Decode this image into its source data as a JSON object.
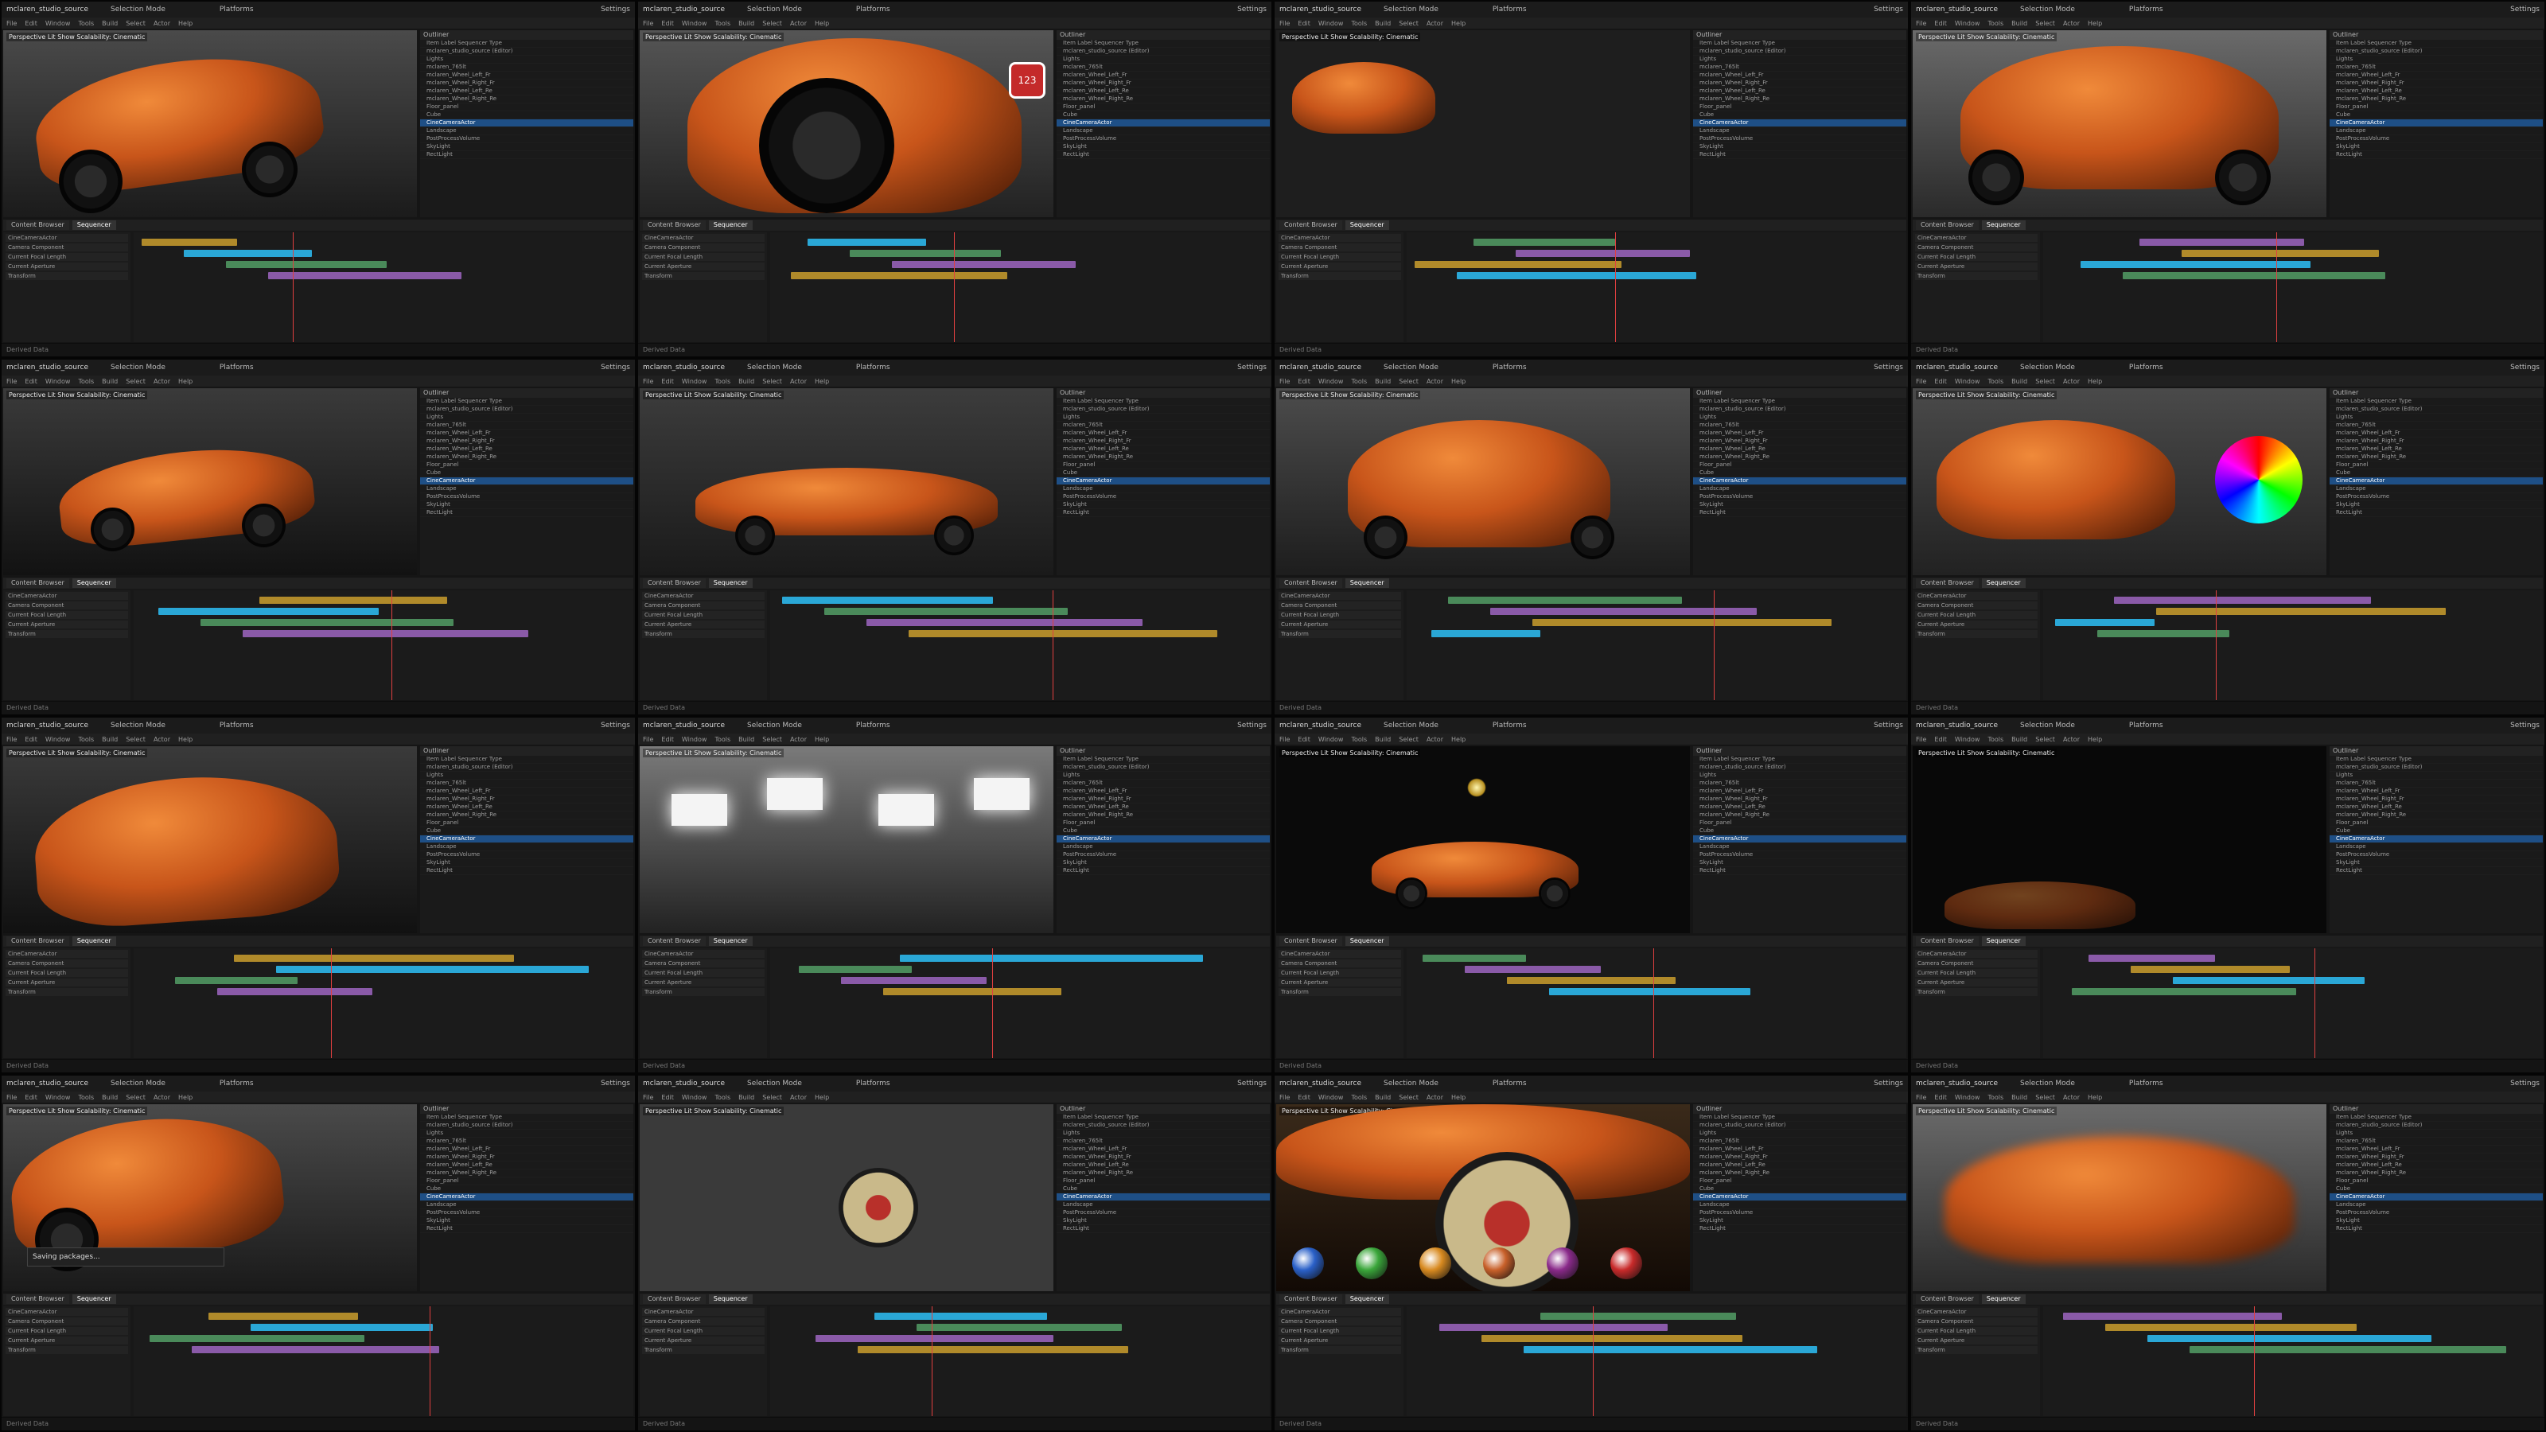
{
  "app": {
    "window_title": "mclaren_studio_source",
    "menus": [
      "File",
      "Edit",
      "Window",
      "Tools",
      "Build",
      "Select",
      "Actor",
      "Help"
    ],
    "mode_label": "Selection Mode",
    "platforms_label": "Platforms",
    "settings_label": "Settings"
  },
  "viewport_tags": [
    "Perspective",
    "Lit",
    "Show",
    "Scalability: Cinematic"
  ],
  "outliner": {
    "header": "Outliner",
    "columns": [
      "Item Label",
      "Sequencer",
      "Type"
    ],
    "rows": [
      "mclaren_studio_source (Editor)",
      "Lights",
      "mclaren_765lt",
      "mclaren_Wheel_Left_Fr",
      "mclaren_Wheel_Right_Fr",
      "mclaren_Wheel_Left_Re",
      "mclaren_Wheel_Right_Re",
      "Floor_panel",
      "Cube",
      "CineCameraActor",
      "Landscape",
      "PostProcessVolume",
      "SkyLight",
      "RectLight"
    ],
    "selected_index": 9
  },
  "bottom_tabs": [
    "Content Browser",
    "Sequencer"
  ],
  "tracks": [
    "CineCameraActor",
    "Camera Component",
    "Current Focal Length",
    "Current Aperture",
    "Transform"
  ],
  "cells": [
    {
      "label": "front-three-quarter"
    },
    {
      "label": "wheel-closeup",
      "badge": "123"
    },
    {
      "label": "material-editor"
    },
    {
      "label": "top-front-view"
    },
    {
      "label": "rear-three-quarter"
    },
    {
      "label": "side-profile"
    },
    {
      "label": "rear-top-view"
    },
    {
      "label": "interior-color-picker"
    },
    {
      "label": "interior-cockpit"
    },
    {
      "label": "studio-lights"
    },
    {
      "label": "dark-studio-car"
    },
    {
      "label": "dark-studio-lights"
    },
    {
      "label": "saving-packages",
      "message": "Saving packages..."
    },
    {
      "label": "wheel-model"
    },
    {
      "label": "wheel-closeup-materials"
    },
    {
      "label": "motion-blur"
    }
  ],
  "statusbar": "Derived Data",
  "colors": {
    "car_orange": "#c8551a",
    "accent_blue": "#1e6fd9",
    "track_yellow": "#b08a2a",
    "track_cyan": "#2aa7d6"
  }
}
